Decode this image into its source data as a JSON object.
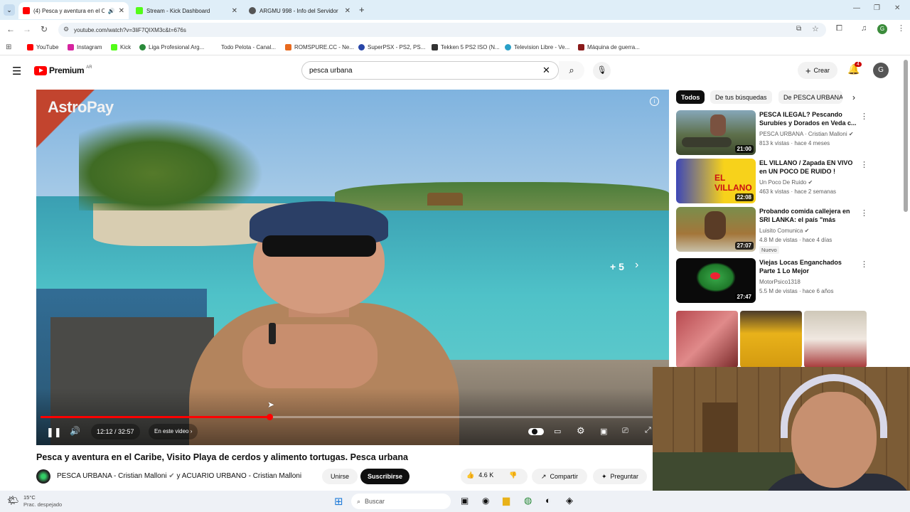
{
  "tabs": [
    {
      "title": "(4) Pesca y aventura en el C",
      "active": true
    },
    {
      "title": "Stream - Kick Dashboard",
      "active": false
    },
    {
      "title": "ARGMU 998 - Info del Servidor",
      "active": false
    }
  ],
  "address": {
    "url": "youtube.com/watch?v=3liF7QIXM3c&t=676s"
  },
  "bookmarks": [
    "YouTube",
    "Instagram",
    "Kick",
    "Liga Profesional Arg...",
    "Todo Pelota - Canal...",
    "ROMSPURE.CC - Ne...",
    "SuperPSX - PS2, PS...",
    "Tekken 5 PS2 ISO (N...",
    "Television Libre - Ve...",
    "Máquina de guerra..."
  ],
  "yt": {
    "logo": "Premium",
    "region": "AR",
    "search_value": "pesca urbana",
    "create_label": "Crear",
    "notif_count": "4",
    "avatar": "G"
  },
  "video": {
    "brand": "AstroPay",
    "more_count": "+ 5",
    "time": "12:12 / 32:57",
    "chapter": "En este video",
    "progress": 0.37,
    "title": "Pesca y aventura en el Caribe, Visito Playa de cerdos y alimento tortugas. Pesca urbana",
    "channel": "PESCA URBANA - Cristian Malloni",
    "collab_sep": "y",
    "channel2": "ACUARIO URBANO - Cristian Malloni",
    "join_label": "Unirse",
    "subscribe_label": "Suscribirse",
    "likes": "4.6 K",
    "share_label": "Compartir",
    "ask_label": "Preguntar"
  },
  "chips": [
    "Todos",
    "De tus búsquedas",
    "De PESCA URBANA"
  ],
  "recommendations": [
    {
      "title": "PESCA ILEGAL? Pescando Surubíes y Dorados en Veda c...",
      "channel": "PESCA URBANA · Cristian Malloni",
      "meta": "813 k vistas · hace 4 meses",
      "duration": "21:00",
      "badge": ""
    },
    {
      "title": "EL VILLANO / Zapada EN VIVO en UN POCO DE RUIDO !",
      "channel": "Un Poco De Ruido",
      "meta": "463 k vistas · hace 2 semanas",
      "duration": "22:08",
      "badge": ""
    },
    {
      "title": "Probando comida callejera en SRI LANKA: el país \"más barat...",
      "channel": "Luisito Comunica",
      "meta": "4.8 M de vistas · hace 4 días",
      "duration": "27:07",
      "badge": "Nuevo"
    },
    {
      "title": "Viejas Locas Enganchados Parte 1 Lo Mejor",
      "channel": "MotorPsico1318",
      "meta": "5.5 M de vistas · hace 6 años",
      "duration": "27:47",
      "badge": ""
    }
  ],
  "taskbar": {
    "temp": "15°C",
    "weather": "Prac. despejado",
    "search": "Buscar"
  },
  "colors": {
    "yt_red": "#ff0000",
    "progress": "#f00",
    "taskbar": "#eef1f6"
  }
}
